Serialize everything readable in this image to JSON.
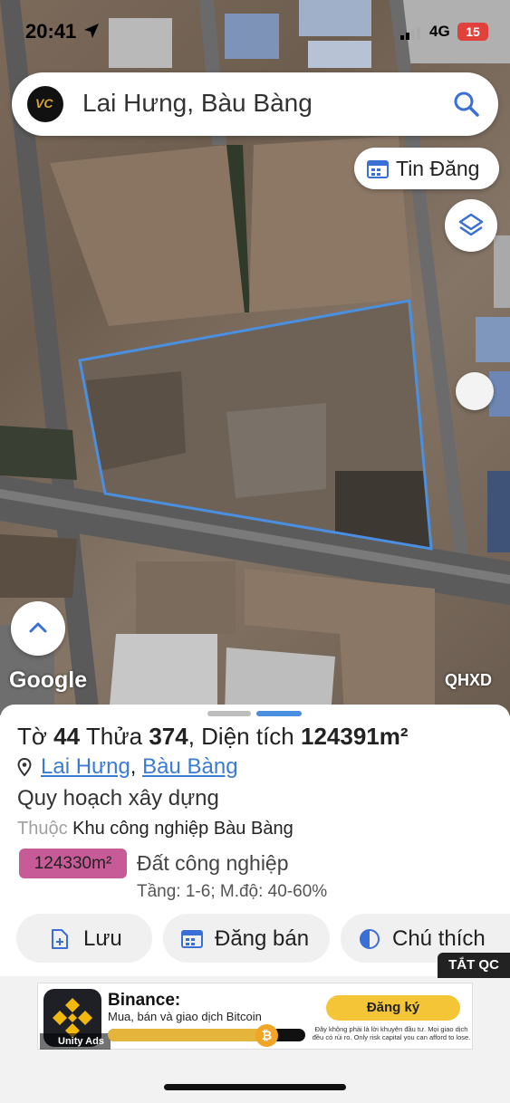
{
  "status_bar": {
    "time": "20:41",
    "network": "4G",
    "battery": "15"
  },
  "search": {
    "query": "Lai Hưng, Bàu Bàng",
    "logo_text": "VC"
  },
  "map": {
    "tin_dang_label": "Tin Đăng",
    "google_label": "Google",
    "overlay_label": "QHXD",
    "parcel_outline_color": "#4a8fe0"
  },
  "parcel": {
    "to_label": "Tờ",
    "to_number": "44",
    "thua_label": "Thửa",
    "thua_number": "374",
    "area_label": "Diện tích",
    "area_value": "124391m²",
    "ward": "Lai Hưng",
    "district": "Bàu Bàng",
    "separator": ",",
    "plan_heading": "Quy hoạch xây dựng",
    "zone_prefix": "Thuộc",
    "zone_name": "Khu công nghiệp Bàu Bàng",
    "zoned_area": "124330m²",
    "zoned_area_color": "#c75b97",
    "land_use": "Đất công nghiệp",
    "floors": "Tầng: 1-6; M.độ: 40-60%"
  },
  "actions": {
    "save": "Lưu",
    "post_sale": "Đăng bán",
    "legend": "Chú thích"
  },
  "ad": {
    "close_label": "TẮT QC",
    "brand": "Binance:",
    "tagline": "Mua, bán và giao dịch Bitcoin",
    "cta": "Đăng ký",
    "disclaimer": "Đây không phải là lời khuyên đầu tư. Mọi giao dịch đều có rủi ro. Only risk capital you can afford to lose.",
    "badge": "Unity Ads",
    "progress": 0.85
  }
}
